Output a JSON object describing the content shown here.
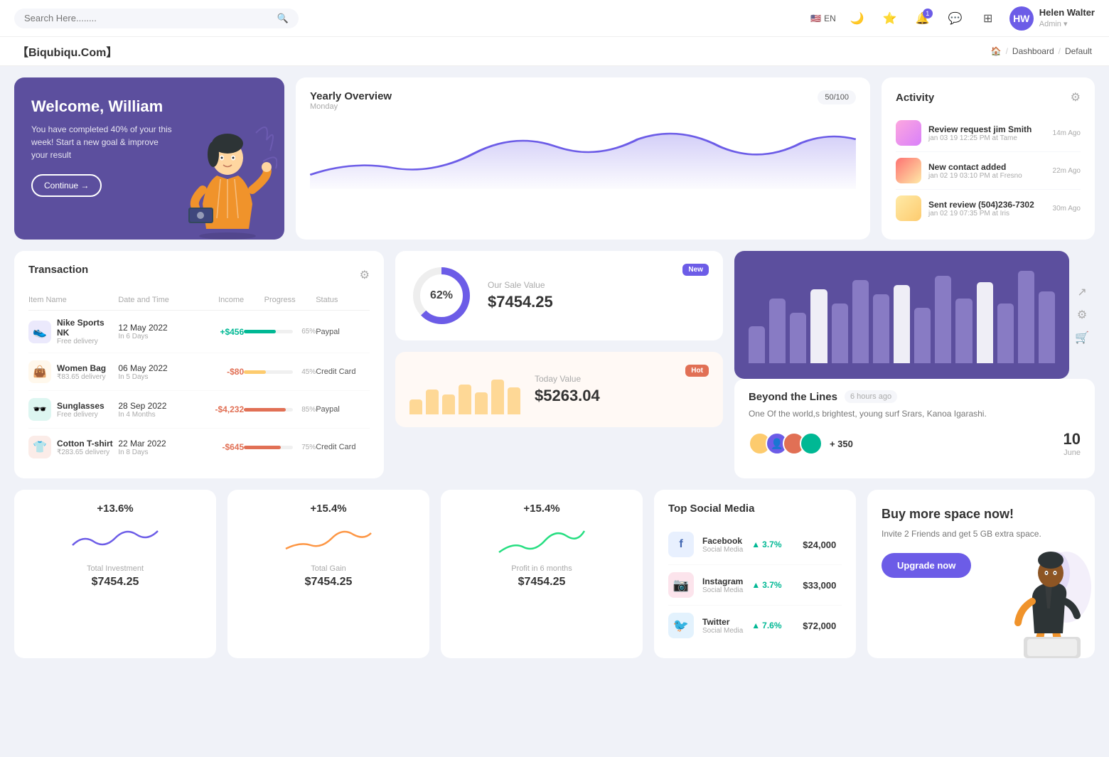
{
  "nav": {
    "search_placeholder": "Search Here........",
    "search_icon": "🔍",
    "lang": "EN",
    "notification_count": "1",
    "user": {
      "name": "Helen Walter",
      "role": "Admin",
      "initials": "HW"
    }
  },
  "breadcrumb": {
    "brand": "【Biqubiqu.Com】",
    "home": "🏠",
    "separator": "/",
    "dashboard": "Dashboard",
    "page": "Default"
  },
  "welcome": {
    "title": "Welcome, William",
    "subtitle": "You have completed 40% of your this week! Start a new goal & improve your result",
    "button": "Continue →"
  },
  "yearly_overview": {
    "title": "Yearly Overview",
    "day": "Monday",
    "count": "50/100"
  },
  "activity": {
    "title": "Activity",
    "items": [
      {
        "title": "Review request jim Smith",
        "subtitle": "jan 03 19 12:25 PM at Tame",
        "ago": "14m Ago"
      },
      {
        "title": "New contact added",
        "subtitle": "jan 02 19 03:10 PM at Fresno",
        "ago": "22m Ago"
      },
      {
        "title": "Sent review (504)236-7302",
        "subtitle": "jan 02 19 07:35 PM at Iris",
        "ago": "30m Ago"
      }
    ]
  },
  "transaction": {
    "title": "Transaction",
    "headers": [
      "Item Name",
      "Date and Time",
      "Income",
      "Progress",
      "Status"
    ],
    "rows": [
      {
        "name": "Nike Sports NK",
        "sub": "Free delivery",
        "date": "12 May 2022",
        "date_sub": "In 6 Days",
        "income": "+$456",
        "income_type": "pos",
        "progress": 65,
        "status": "Paypal",
        "color": "#6c5ce7",
        "icon": "👟"
      },
      {
        "name": "Women Bag",
        "sub": "₹83.65 delivery",
        "date": "06 May 2022",
        "date_sub": "In 5 Days",
        "income": "-$80",
        "income_type": "neg",
        "progress": 45,
        "status": "Credit Card",
        "color": "#fdcb6e",
        "icon": "👜"
      },
      {
        "name": "Sunglasses",
        "sub": "Free delivery",
        "date": "28 Sep 2022",
        "date_sub": "In 4 Months",
        "income": "-$4,232",
        "income_type": "neg",
        "progress": 85,
        "status": "Paypal",
        "color": "#00b894",
        "icon": "🕶️"
      },
      {
        "name": "Cotton T-shirt",
        "sub": "₹283.65 delivery",
        "date": "22 Mar 2022",
        "date_sub": "In 8 Days",
        "income": "-$645",
        "income_type": "neg",
        "progress": 75,
        "status": "Credit Card",
        "color": "#e17055",
        "icon": "👕"
      }
    ]
  },
  "sale_value": {
    "title": "Our Sale Value",
    "amount": "$7454.25",
    "percentage": "62%",
    "badge": "New"
  },
  "today_value": {
    "title": "Today Value",
    "amount": "$5263.04",
    "badge": "Hot",
    "bars": [
      30,
      50,
      40,
      60,
      45,
      70,
      55
    ]
  },
  "bar_chart": {
    "bars": [
      40,
      70,
      55,
      80,
      65,
      90,
      75,
      85,
      60,
      95,
      70,
      88,
      65,
      100,
      78
    ],
    "bar_colors": [
      "#9b8fd4",
      "#9b8fd4",
      "#9b8fd4",
      "#fff",
      "#9b8fd4",
      "#9b8fd4",
      "#9b8fd4",
      "#fff",
      "#9b8fd4",
      "#9b8fd4",
      "#9b8fd4",
      "#fff",
      "#9b8fd4",
      "#9b8fd4",
      "#9b8fd4"
    ]
  },
  "beyond": {
    "title": "Beyond the Lines",
    "time_ago": "6 hours ago",
    "description": "One Of the world,s brightest, young surf Srars, Kanoa Igarashi.",
    "plus_count": "+ 350",
    "date_day": "10",
    "date_month": "June"
  },
  "mini_stats": [
    {
      "percent": "+13.6%",
      "label": "Total Investment",
      "value": "$7454.25",
      "color": "#6c5ce7"
    },
    {
      "percent": "+15.4%",
      "label": "Total Gain",
      "value": "$7454.25",
      "color": "#fd9644"
    },
    {
      "percent": "+15.4%",
      "label": "Profit in 6 months",
      "value": "$7454.25",
      "color": "#26de81"
    }
  ],
  "social_media": {
    "title": "Top Social Media",
    "items": [
      {
        "name": "Facebook",
        "type": "Social Media",
        "growth": "3.7%",
        "amount": "$24,000",
        "color": "#4267B2",
        "icon": "f"
      },
      {
        "name": "Instagram",
        "type": "Social Media",
        "growth": "3.7%",
        "amount": "$33,000",
        "color": "#e1306c",
        "icon": "📷"
      },
      {
        "name": "Twitter",
        "type": "Social Media",
        "growth": "7.6%",
        "amount": "$72,000",
        "color": "#1da1f2",
        "icon": "🐦"
      }
    ]
  },
  "buy_space": {
    "title": "Buy more space now!",
    "description": "Invite 2 Friends and get 5 GB extra space.",
    "button": "Upgrade now"
  }
}
